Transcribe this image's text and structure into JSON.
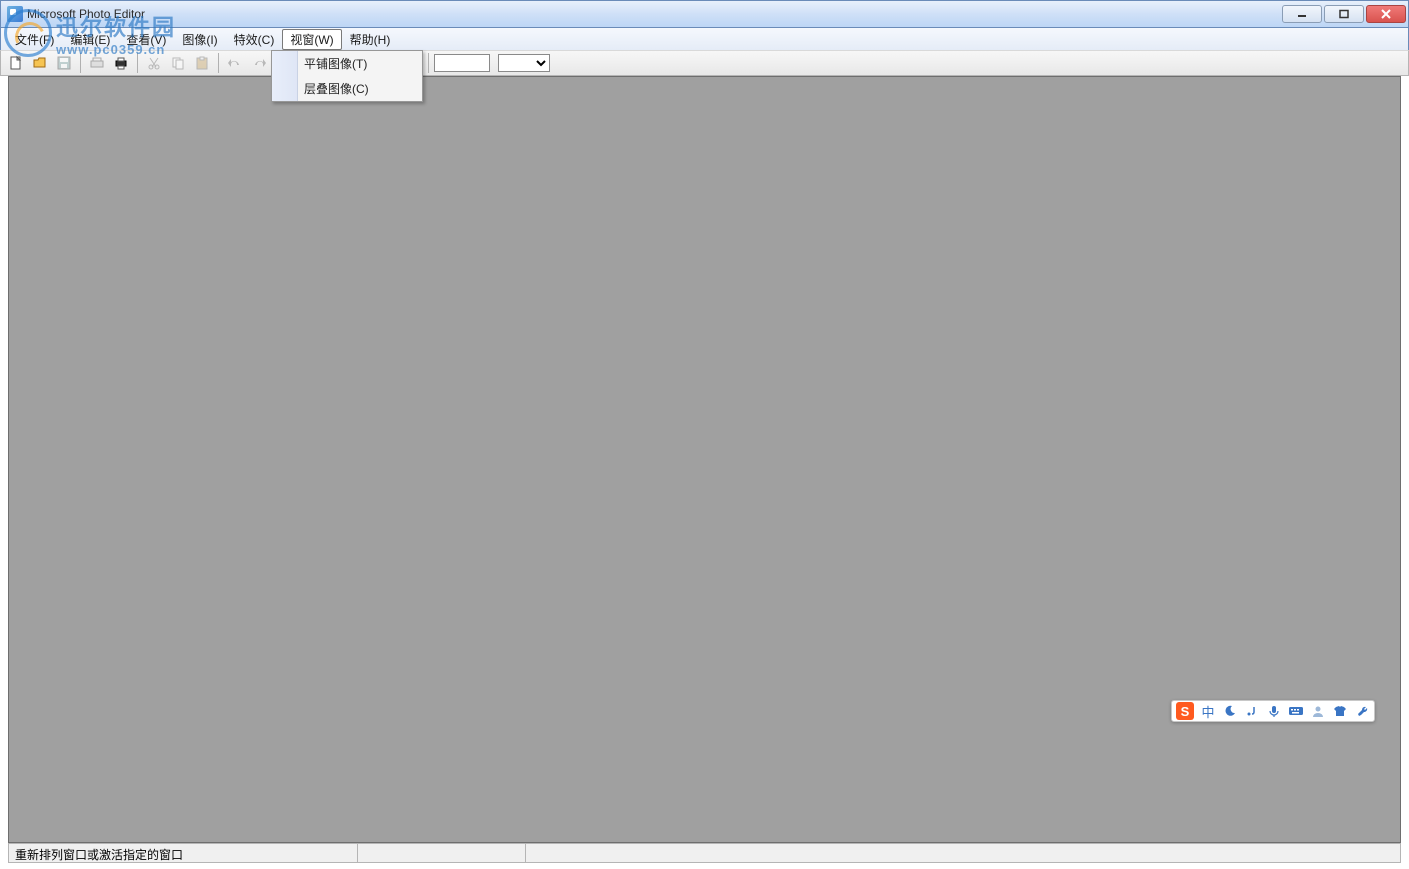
{
  "title": "Microsoft Photo Editor",
  "menubar": {
    "file": "文件(F)",
    "edit": "编辑(E)",
    "view": "查看(V)",
    "image": "图像(I)",
    "effects": "特效(C)",
    "window": "视窗(W)",
    "help": "帮助(H)"
  },
  "dropdown": {
    "tile": "平铺图像(T)",
    "cascade": "层叠图像(C)"
  },
  "toolbar": {
    "zoom_placeholder": ""
  },
  "statusbar": {
    "hint": "重新排列窗口或激活指定的窗口"
  },
  "watermark": {
    "cn": "迅尔软件园",
    "url": "www.pc0359.cn"
  },
  "ime": {
    "logo": "S",
    "lang": "中"
  }
}
